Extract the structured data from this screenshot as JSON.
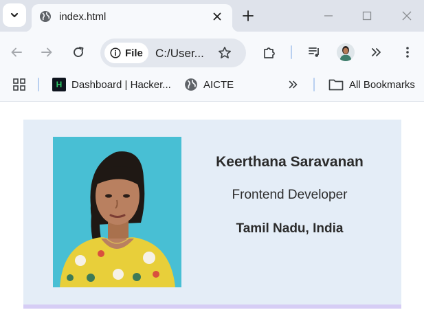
{
  "browser": {
    "tab": {
      "title": "index.html",
      "favicon": "globe-icon"
    },
    "address_bar": {
      "chip_label": "File",
      "url": "C:/User..."
    },
    "bookmarks": [
      {
        "label": "Dashboard | Hacker...",
        "icon": "hackerrank-icon"
      },
      {
        "label": "AICTE",
        "icon": "globe-icon"
      }
    ],
    "all_bookmarks_label": "All Bookmarks",
    "hackerrank_logo_text": "H"
  },
  "profile": {
    "name": "Keerthana Saravanan",
    "role": "Frontend Developer",
    "location": "Tamil Nadu, India"
  },
  "colors": {
    "tabstrip": "#dfe3eb",
    "toolbar": "#f7f9fc",
    "card_background": "#e4edf7",
    "card_accent": "#d6cdf5",
    "photo_background": "#48bfd4"
  }
}
